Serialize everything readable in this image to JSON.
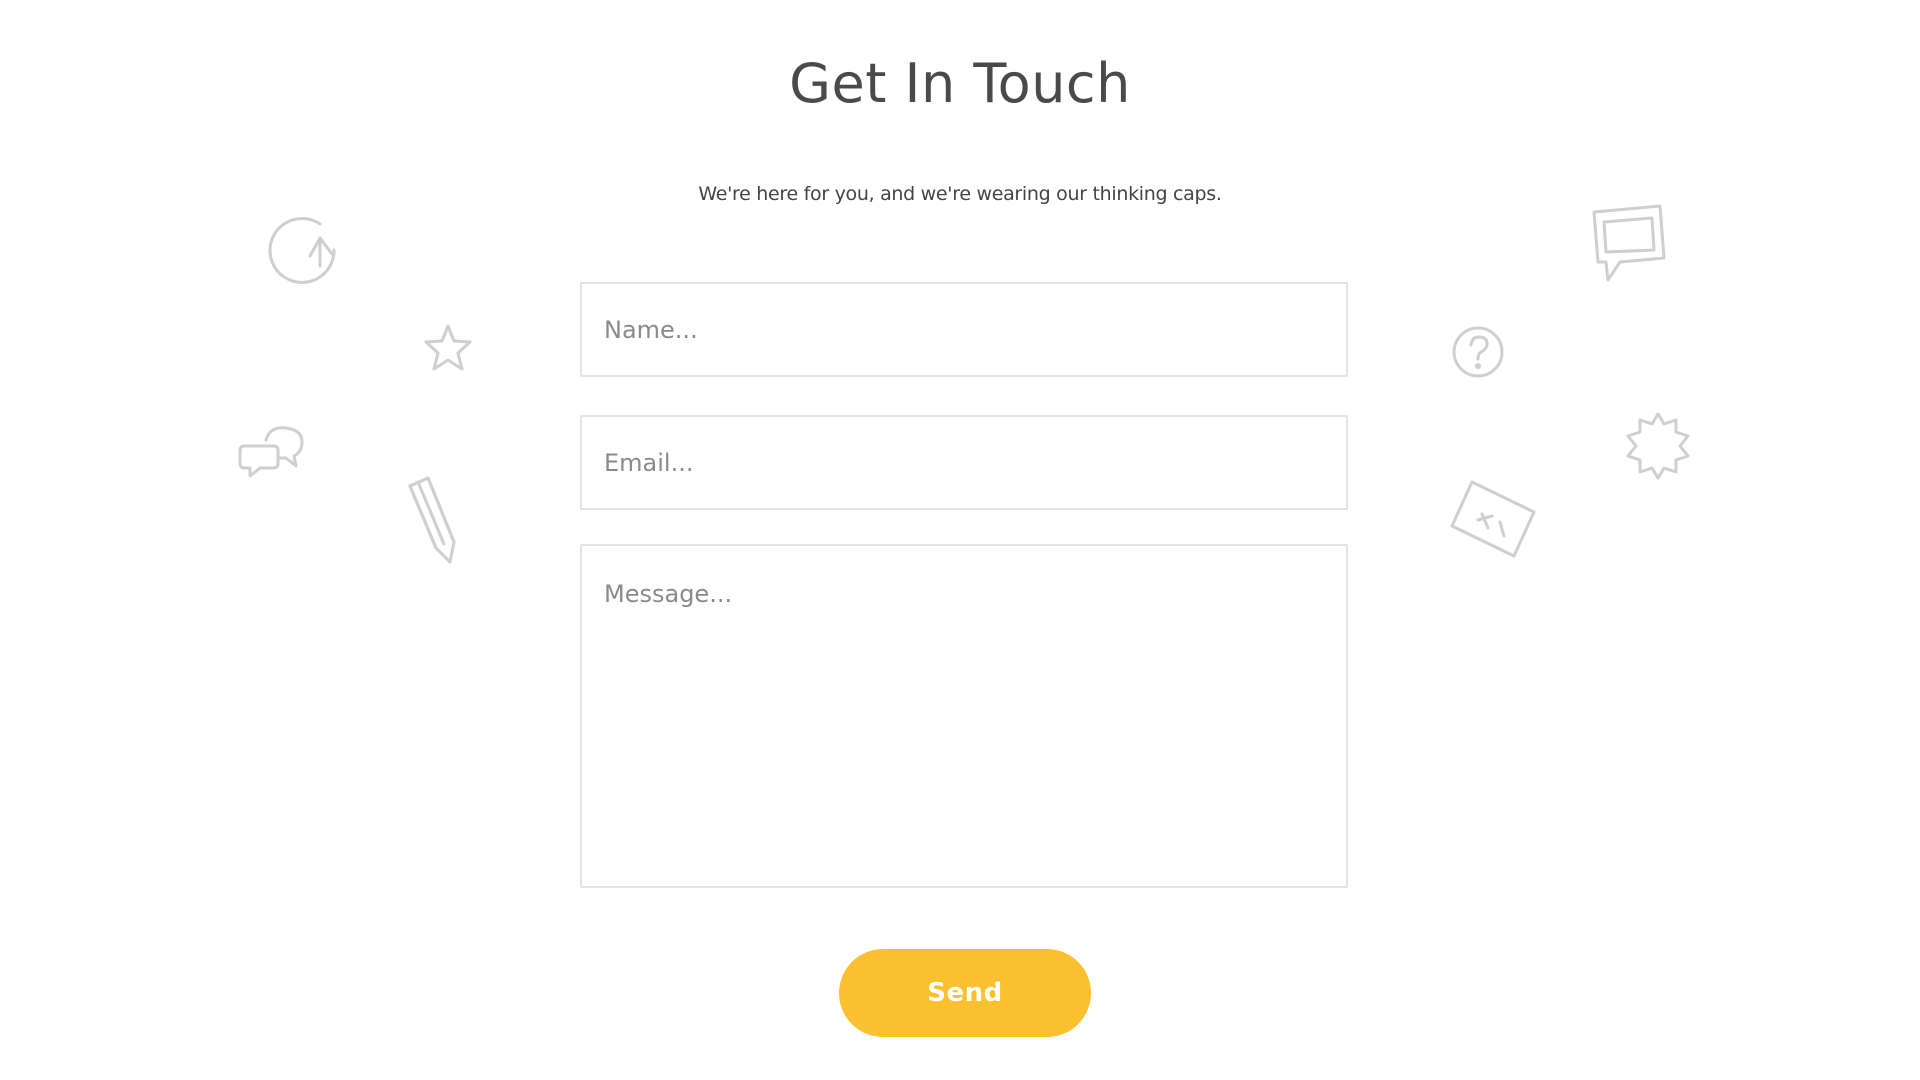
{
  "page": {
    "title": "Get In Touch",
    "subtitle": "We're here for you, and we're wearing our thinking caps."
  },
  "form": {
    "name_placeholder": "Name...",
    "email_placeholder": "Email...",
    "message_placeholder": "Message...",
    "send_label": "Send"
  },
  "colors": {
    "accent": "#fbc02d",
    "title_text": "#4a4a4a",
    "field_border": "#e3e3e3",
    "decor_icons": "#cfcfcf"
  },
  "decorations": {
    "icons": [
      "refresh-icon",
      "star-icon",
      "chat-bubbles-icon",
      "pencil-icon",
      "speech-bubble-icon",
      "question-icon",
      "badge-icon",
      "tag-icon"
    ]
  }
}
